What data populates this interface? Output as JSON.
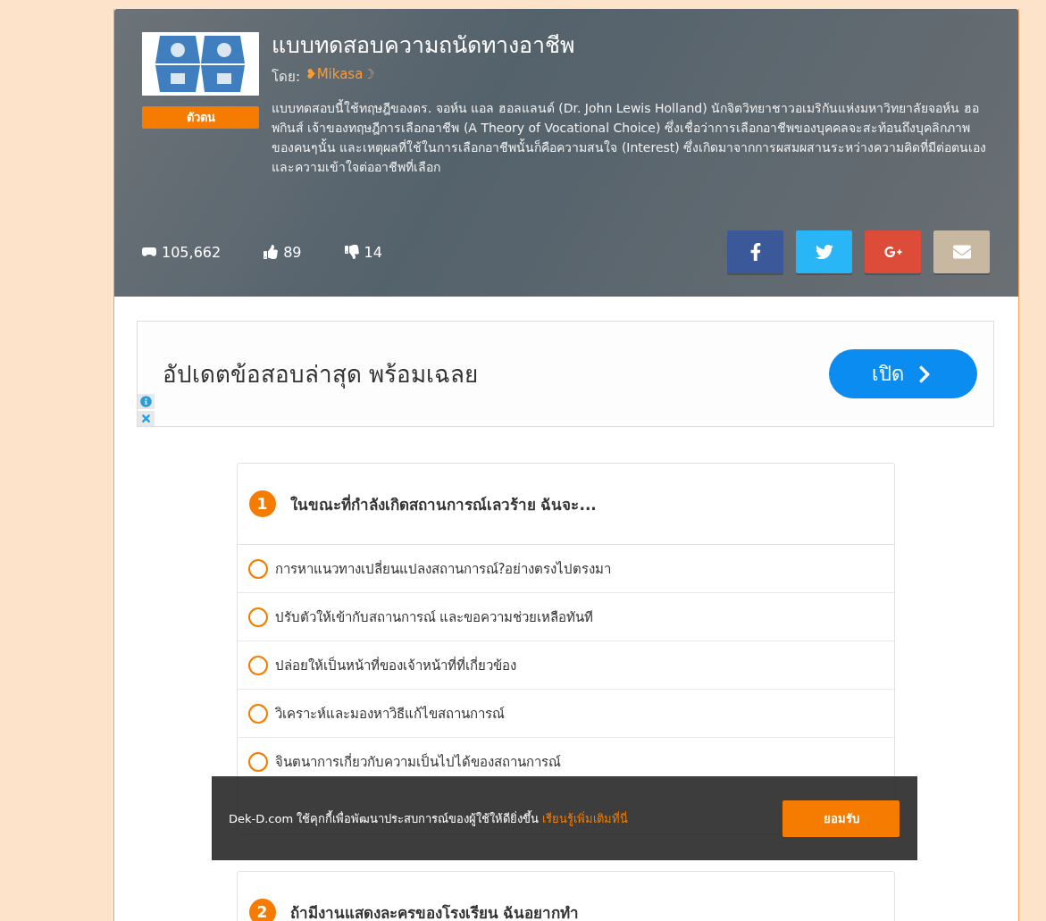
{
  "quiz": {
    "title": "แบบทดสอบความถนัดทางอาชีพ",
    "author_label": "โดย:",
    "author": "❥Mikasa☽",
    "tag": "ตัวตน",
    "description": "แบบทดสอบนี้ใช้ทฤษฎีของดร. จอห์น แอล ฮอลแลนด์ (Dr. John Lewis Holland) นักจิตวิทยาชาวอเมริกันแห่งมหาวิทยาลัยจอห์น ฮอพกินส์ เจ้าของทฤษฎีการเลือกอาชีพ (A Theory of Vocational Choice) ซึ่งเชื่อว่าการเลือกอาชีพของบุคคลจะสะท้อนถึงบุคลิกภาพของคนๆนั้น และเหตุผลที่ใช้ในการเลือกอาชีพนั้นก็คือความสนใจ (Interest) ซึ่งเกิดมาจากการผสมผสานระหว่างความคิดที่มีต่อตนเองและความเข้าใจต่ออาชีพที่เลือก",
    "stats": [
      {
        "kind": "plays",
        "value": "105,662"
      },
      {
        "kind": "likes",
        "value": "89"
      },
      {
        "kind": "dislikes",
        "value": "14"
      }
    ],
    "share": [
      {
        "kind": "facebook"
      },
      {
        "kind": "twitter"
      },
      {
        "kind": "googleplus"
      },
      {
        "kind": "email"
      }
    ]
  },
  "ad": {
    "text": "อัปเดตข้อสอบล่าสุด พร้อมเฉลย",
    "button": "เปิด"
  },
  "questions": [
    {
      "number": "1",
      "text": "ในขณะที่กำลังเกิดสถานการณ์เลวร้าย ฉันจะ...",
      "options": [
        {
          "label": "การหาแนวทางเปลี่ยนแปลงสถานการณ์?อย่างตรงไปตรงมา",
          "selected": false
        },
        {
          "label": "ปรับตัวให้เข้ากับสถานการณ์ และขอความช่วยเหลือทันที",
          "selected": false
        },
        {
          "label": "ปล่อยให้เป็นหน้าที่ของเจ้าหน้าที่ที่เกี่ยวข้อง",
          "selected": false
        },
        {
          "label": "วิเคราะห์และมองหาวิธีแก้ไขสถานการณ์",
          "selected": false
        },
        {
          "label": "จินตนาการเกี่ยวกับความเป็นไปได้ของสถานการณ์",
          "selected": false
        },
        {
          "kind": "covered"
        }
      ]
    },
    {
      "number": "2",
      "text": "ถ้ามีงานแสดงละครของโรงเรียน ฉันอยากทำ"
    }
  ],
  "cookie": {
    "text": "Dek-D.com ใช้คุกกี้เพื่อพัฒนาประสบการณ์ของผู้ใช้ให้ดียิ่งขึ้น",
    "link": "เรียนรู้เพิ่มเติมที่นี่",
    "button": "ยอมรับ"
  }
}
